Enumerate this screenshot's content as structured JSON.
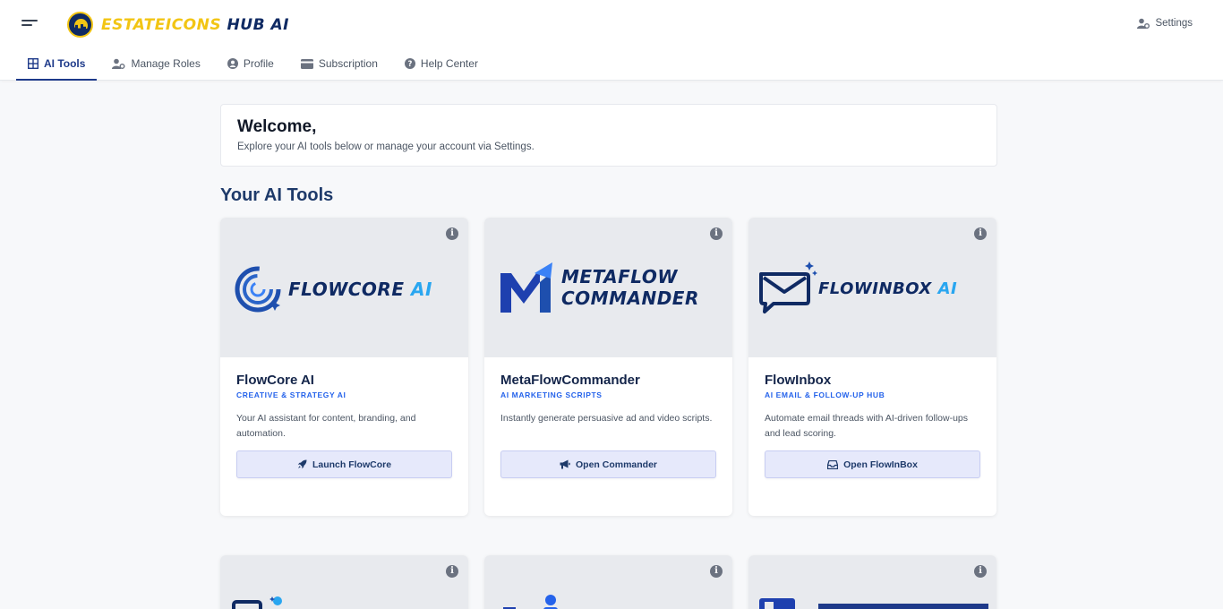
{
  "header": {
    "logo_text_yellow": "ESTATEICONS",
    "logo_text_blue": "HUB AI",
    "settings_label": "Settings"
  },
  "nav": {
    "tabs": [
      {
        "label": "AI Tools",
        "icon": "grid-icon",
        "active": true
      },
      {
        "label": "Manage Roles",
        "icon": "user-cog-icon",
        "active": false
      },
      {
        "label": "Profile",
        "icon": "user-circle-icon",
        "active": false
      },
      {
        "label": "Subscription",
        "icon": "credit-card-icon",
        "active": false
      },
      {
        "label": "Help Center",
        "icon": "question-circle-icon",
        "active": false
      }
    ]
  },
  "welcome": {
    "title": "Welcome,",
    "text": "Explore your AI tools below or manage your account via Settings."
  },
  "tools_section": {
    "title": "Your AI Tools",
    "cards": [
      {
        "name": "FlowCore AI",
        "subtitle": "CREATIVE & STRATEGY AI",
        "description": "Your AI assistant for content, branding, and automation.",
        "button": "Launch FlowCore",
        "button_icon": "rocket-icon",
        "logo_line1": "FLOWCORE",
        "logo_line1_accent": "AI"
      },
      {
        "name": "MetaFlowCommander",
        "subtitle": "AI MARKETING SCRIPTS",
        "description": "Instantly generate persuasive ad and video scripts.",
        "button": "Open Commander",
        "button_icon": "megaphone-icon",
        "logo_line1": "METAFLOW",
        "logo_line2": "COMMANDER"
      },
      {
        "name": "FlowInbox",
        "subtitle": "AI EMAIL & FOLLOW-UP HUB",
        "description": "Automate email threads with AI-driven follow-ups and lead scoring.",
        "button": "Open FlowInBox",
        "button_icon": "inbox-icon",
        "logo_line1": "FLOWINBOX",
        "logo_line1_accent": "AI"
      }
    ]
  },
  "colors": {
    "brand_navy": "#1e3a8a",
    "brand_yellow": "#f2c514",
    "accent_blue": "#2563eb",
    "button_bg": "#e6e9fb"
  }
}
